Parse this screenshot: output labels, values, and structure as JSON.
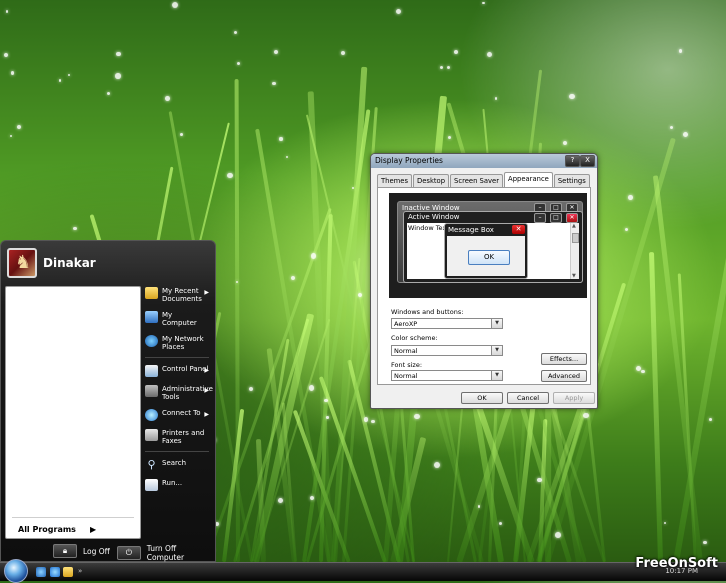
{
  "start_menu": {
    "user_name": "Dinakar",
    "right_items": [
      {
        "label": "My Recent Documents",
        "icon": "folder-icon",
        "submenu": true
      },
      {
        "label": "My Computer",
        "icon": "computer-icon",
        "submenu": false
      },
      {
        "label": "My Network Places",
        "icon": "network-icon",
        "submenu": false
      },
      {
        "label": "Control Panel",
        "icon": "control-panel-icon",
        "submenu": true
      },
      {
        "label": "Administrative Tools",
        "icon": "admin-tools-icon",
        "submenu": true
      },
      {
        "label": "Connect To",
        "icon": "connect-icon",
        "submenu": true
      },
      {
        "label": "Printers and Faxes",
        "icon": "printer-icon",
        "submenu": false
      },
      {
        "label": "Search",
        "icon": "search-icon",
        "submenu": false
      },
      {
        "label": "Run...",
        "icon": "run-icon",
        "submenu": false
      }
    ],
    "all_programs": "All Programs",
    "log_off": "Log Off",
    "turn_off": "Turn Off Computer"
  },
  "taskbar": {
    "clock": "10:17 PM"
  },
  "watermark": "FreeOnSoft",
  "dialog": {
    "title": "Display Properties",
    "help_button": "?",
    "close_button": "X",
    "tabs": [
      "Themes",
      "Desktop",
      "Screen Saver",
      "Appearance",
      "Settings"
    ],
    "active_tab": "Appearance",
    "preview": {
      "inactive_window": "Inactive Window",
      "active_window": "Active Window",
      "window_text": "Window Text",
      "message_box": "Message Box",
      "ok": "OK"
    },
    "windows_and_buttons_label": "Windows and buttons:",
    "windows_and_buttons_value": "AeroXP",
    "color_scheme_label": "Color scheme:",
    "color_scheme_value": "Normal",
    "font_size_label": "Font size:",
    "font_size_value": "Normal",
    "effects_button": "Effects...",
    "advanced_button": "Advanced",
    "ok_button": "OK",
    "cancel_button": "Cancel",
    "apply_button": "Apply"
  }
}
